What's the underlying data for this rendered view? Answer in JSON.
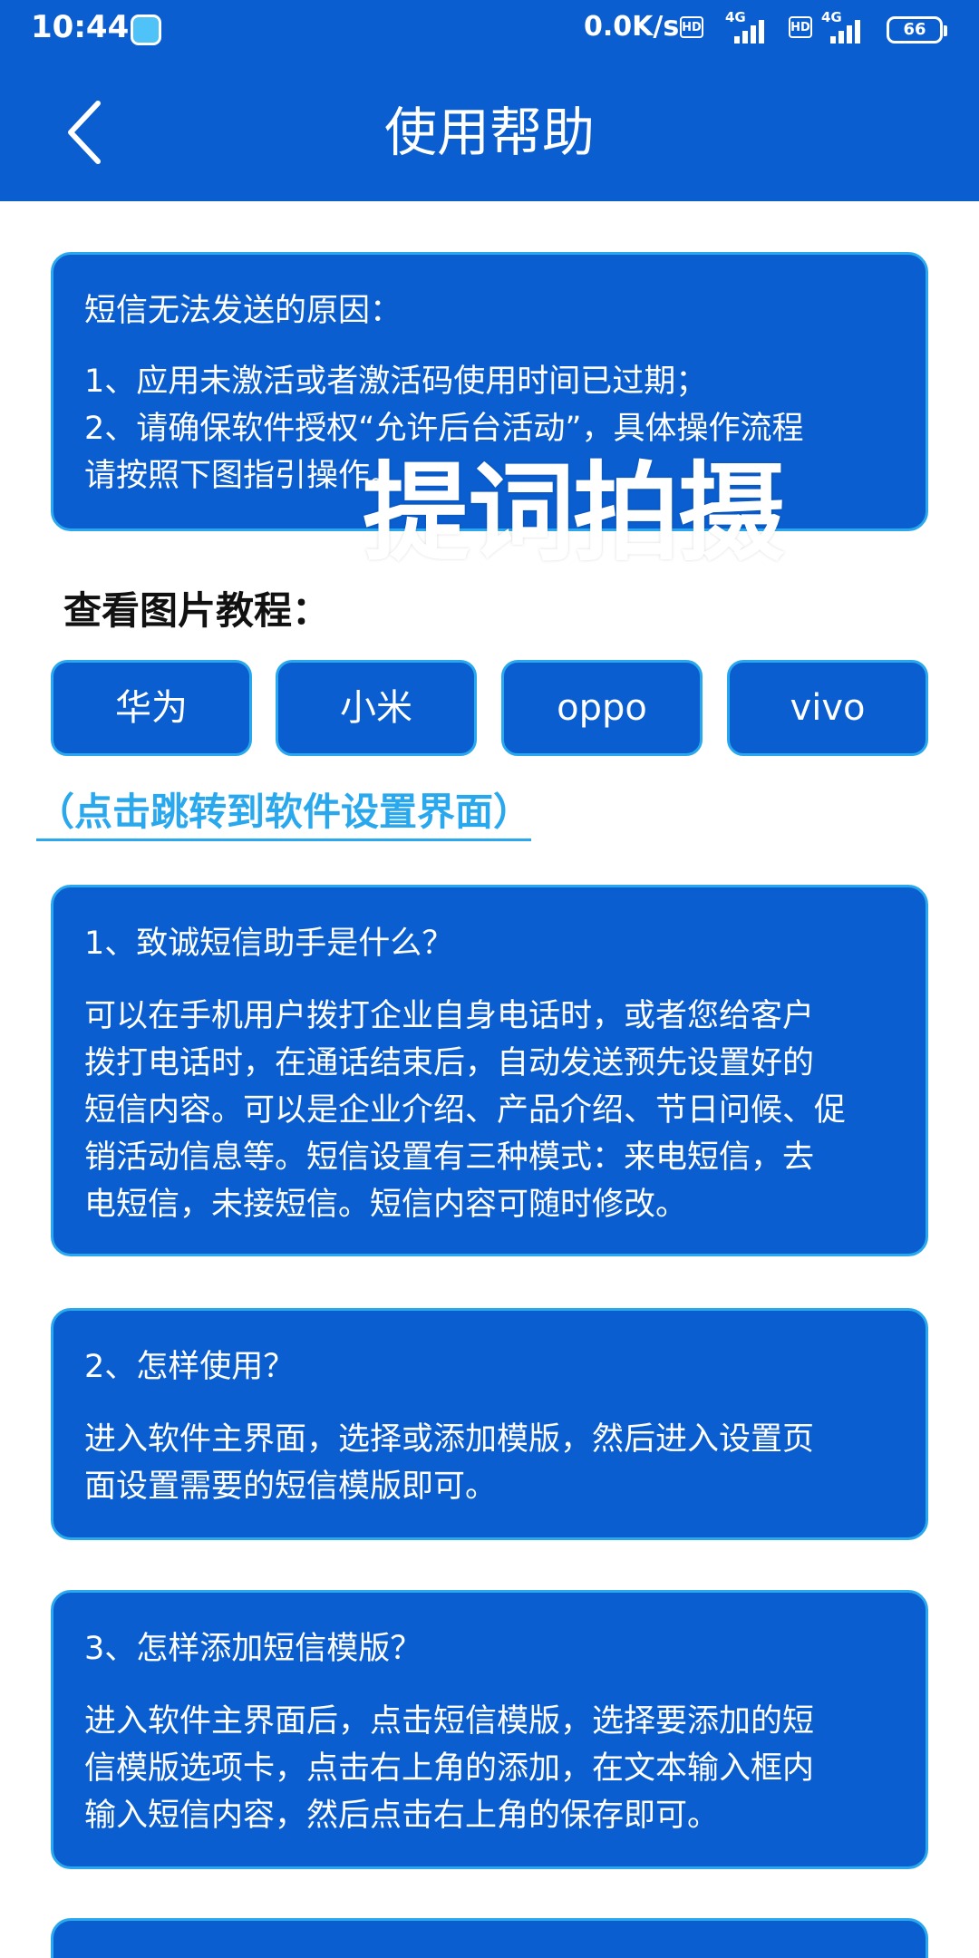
{
  "status_bar": {
    "time": "10:44",
    "speed": "0.0K/s",
    "hd_label": "HD",
    "network_label": "4G",
    "battery": "66"
  },
  "header": {
    "title": "使用帮助",
    "back_icon": "chevron-left-icon"
  },
  "notice": {
    "title": "短信无法发送的原因：",
    "lines": [
      "1、应用未激活或者激活码使用时间已过期；",
      "2、请确保软件授权“允许后台活动”，具体操作流程",
      "请按照下图指引操作。"
    ]
  },
  "watermark": "提词拍摄",
  "tutorial": {
    "label": "查看图片教程：",
    "buttons": [
      "华为",
      "小米",
      "oppo",
      "vivo"
    ],
    "settings_link": "（点击跳转到软件设置界面）"
  },
  "faq": [
    {
      "question": "1、致诚短信助手是什么？",
      "answer_lines": [
        "可以在手机用户拨打企业自身电话时，或者您给客户",
        "拨打电话时，在通话结束后，自动发送预先设置好的",
        "短信内容。可以是企业介绍、产品介绍、节日问候、促",
        "销活动信息等。短信设置有三种模式：来电短信，去",
        "电短信，未接短信。短信内容可随时修改。"
      ]
    },
    {
      "question": "2、怎样使用？",
      "answer_lines": [
        "进入软件主界面，选择或添加模版，然后进入设置页",
        "面设置需要的短信模版即可。"
      ]
    },
    {
      "question": "3、怎样添加短信模版？",
      "answer_lines": [
        "进入软件主界面后，点击短信模版，选择要添加的短",
        "信模版选项卡，点击右上角的添加，在文本输入框内",
        "输入短信内容，然后点击右上角的保存即可。"
      ]
    }
  ],
  "colors": {
    "primary": "#0a5ecf",
    "accent": "#29a8ee",
    "text_light": "#ffffff"
  }
}
